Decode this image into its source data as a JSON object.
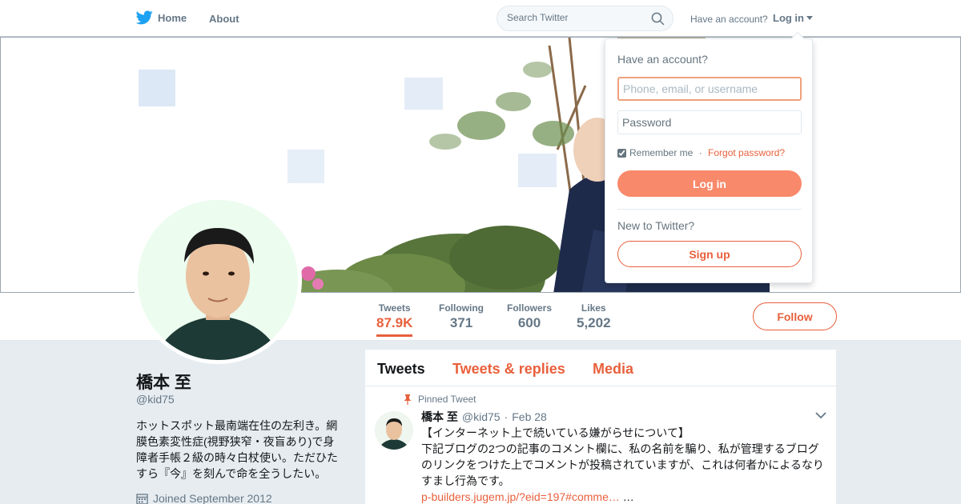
{
  "nav": {
    "home_label": "Home",
    "about_label": "About",
    "search_placeholder": "Search Twitter",
    "have_account": "Have an account?",
    "login_label": "Log in"
  },
  "profile": {
    "name": "橋本 至",
    "handle": "@kid75",
    "bio": "ホットスポット最南端在住の左利き。網膜色素変性症(視野狭窄・夜盲あり)で身障者手帳２級の時々白杖使い。ただひたすら『今』を刻んで命を全うしたい。",
    "joined": "Joined September 2012"
  },
  "stats": [
    {
      "label": "Tweets",
      "value": "87.9K"
    },
    {
      "label": "Following",
      "value": "371"
    },
    {
      "label": "Followers",
      "value": "600"
    },
    {
      "label": "Likes",
      "value": "5,202"
    }
  ],
  "follow_label": "Follow",
  "tabs": [
    "Tweets",
    "Tweets & replies",
    "Media"
  ],
  "pinned_tweet": {
    "pinned_label": "Pinned Tweet",
    "name": "橋本 至",
    "handle": "@kid75",
    "separator": "·",
    "date": "Feb 28",
    "line1": "【インターネット上で続いている嫌がらせについて】",
    "line2": "下記ブログの2つの記事のコメント欄に、私の名前を騙り、私が管理するブログのリンクをつけた上でコメントが投稿されていますが、これは何者かによるなりすまし行為です。",
    "link": "p-builders.jugem.jp/?eid=197#comme…",
    "ellipsis": " …"
  },
  "login_dropdown": {
    "title": "Have an account?",
    "username_placeholder": "Phone, email, or username",
    "password_placeholder": "Password",
    "remember_label": "Remember me",
    "separator": " · ",
    "forgot_label": "Forgot password?",
    "login_button": "Log in",
    "new_label": "New to Twitter?",
    "signup_button": "Sign up"
  },
  "colors": {
    "accent": "#e8603c",
    "login_button": "#f8896a",
    "twitter_blue": "#1da1f2",
    "background": "#e6ecf0"
  },
  "icons": [
    "twitter-bird-icon",
    "search-icon",
    "dropdown-caret-icon",
    "pin-icon",
    "chevron-down-icon",
    "calendar-icon"
  ]
}
